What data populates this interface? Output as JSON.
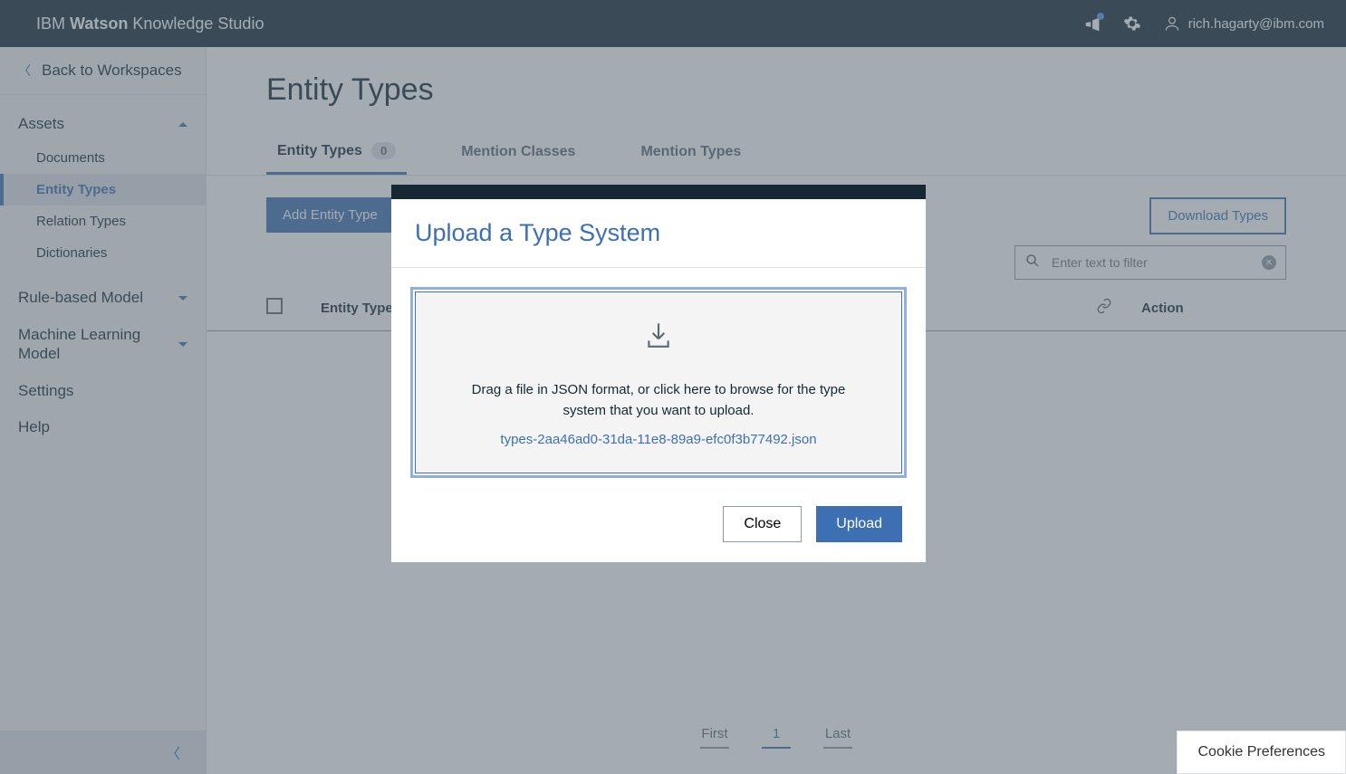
{
  "header": {
    "brand_prefix": "IBM ",
    "brand_bold": "Watson",
    "brand_suffix": " Knowledge Studio",
    "user_email": "rich.hagarty@ibm.com"
  },
  "sidebar": {
    "back_label": "Back to Workspaces",
    "groups": {
      "assets": {
        "label": "Assets"
      },
      "rule_model": {
        "label": "Rule-based Model"
      },
      "ml_model": {
        "label": "Machine Learning Model"
      },
      "settings": {
        "label": "Settings"
      },
      "help": {
        "label": "Help"
      }
    },
    "assets_items": {
      "documents": "Documents",
      "entity_types": "Entity Types",
      "relation_types": "Relation Types",
      "dictionaries": "Dictionaries"
    }
  },
  "page": {
    "title": "Entity Types",
    "tabs": {
      "entity_types": {
        "label": "Entity Types",
        "count": "0"
      },
      "mention_classes": {
        "label": "Mention Classes"
      },
      "mention_types": {
        "label": "Mention Types"
      }
    },
    "toolbar": {
      "add_button": "Add Entity Type",
      "download_button": "Download Types",
      "search_placeholder": "Enter text to filter"
    },
    "table": {
      "col_type": "Entity Types",
      "col_action": "Action"
    },
    "pagination": {
      "first": "First",
      "page": "1",
      "last": "Last"
    }
  },
  "modal": {
    "title": "Upload a Type System",
    "drop_text": "Drag a file in JSON format, or click here to browse for the type system that you want to upload.",
    "filename": "types-2aa46ad0-31da-11e8-89a9-efc0f3b77492.json",
    "close": "Close",
    "upload": "Upload"
  },
  "footer": {
    "cookie": "Cookie Preferences"
  }
}
